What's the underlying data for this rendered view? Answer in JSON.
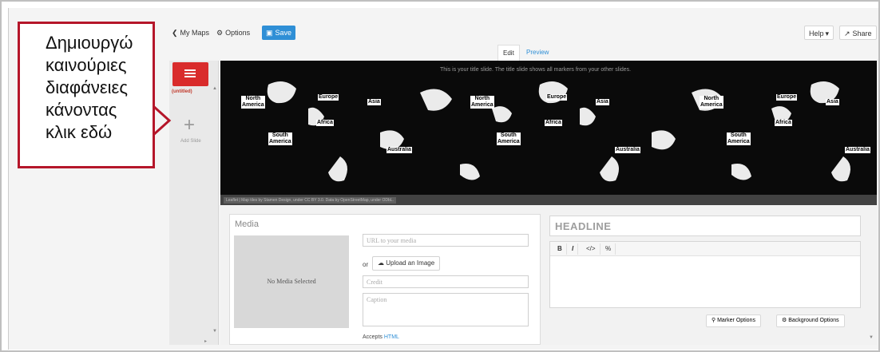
{
  "callout": {
    "text": "Δημιουργώ\nκαινούριες\nδιαφάνειες\nκάνοντας\nκλικ εδώ",
    "border_color": "#b5162a"
  },
  "toolbar": {
    "my_maps": "My Maps",
    "options": "Options",
    "save": "Save",
    "help": "Help",
    "share": "Share"
  },
  "icons": {
    "back": "chevron-left-icon",
    "options": "gear-icon",
    "save": "floppy-icon",
    "help": "caret-down-icon",
    "share": "share-icon",
    "add_slide": "plus-icon",
    "upload": "cloud-upload-icon",
    "marker": "map-marker-icon",
    "background": "gear-icon"
  },
  "tabs": {
    "edit": "Edit",
    "preview": "Preview"
  },
  "slides": {
    "items": [
      {
        "label": "(untitled)"
      }
    ],
    "add_label": "Add Slide",
    "thumb_color": "#d92b2b"
  },
  "map": {
    "title_overlay": "This is your title slide. The title slide shows all markers from your other slides.",
    "attribution": "Leaflet | Map tiles by Stamen Design, under CC BY 3.0. Data by OpenStreetMap, under ODbL.",
    "labels": {
      "north_america": "North\nAmerica",
      "south_america": "South\nAmerica",
      "europe": "Europe",
      "asia": "Asia",
      "africa": "Africa",
      "australia": "Australia"
    }
  },
  "media": {
    "title": "Media",
    "no_media": "No Media Selected",
    "url_placeholder": "URL to your media",
    "or": "or",
    "upload": "Upload an Image",
    "credit_placeholder": "Credit",
    "caption_placeholder": "Caption",
    "accepts_prefix": "Accepts",
    "accepts_link": "HTML"
  },
  "text": {
    "headline_placeholder": "HEADLINE",
    "tools": [
      "B",
      "I",
      "</>",
      "%"
    ],
    "marker_options": "Marker Options",
    "background_options": "Background Options"
  },
  "colors": {
    "accent_blue": "#2f8fd6",
    "slide_red": "#d92b2b",
    "callout_red": "#b5162a"
  }
}
